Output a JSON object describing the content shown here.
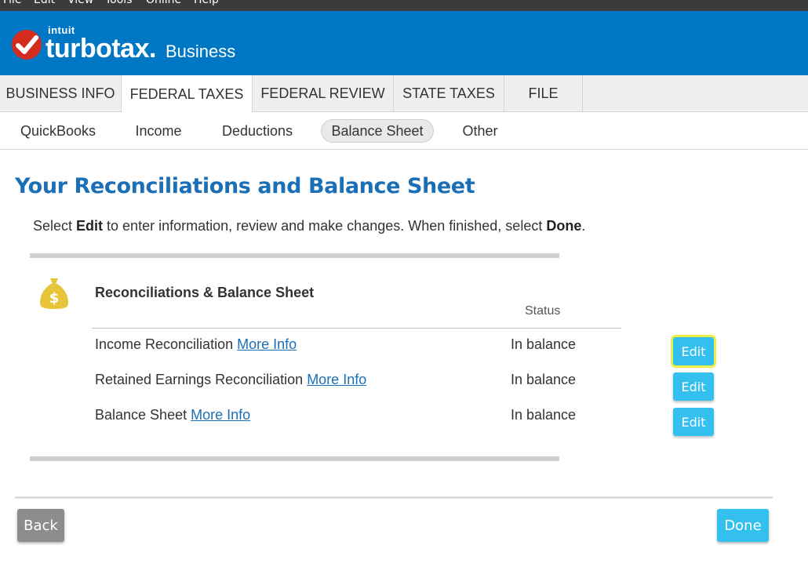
{
  "menu": {
    "items": [
      "File",
      "Edit",
      "View",
      "Tools",
      "Online",
      "Help"
    ]
  },
  "brand": {
    "intuit": "intuit",
    "product": "turbotax.",
    "edition": "Business",
    "background_color": "#0077c5",
    "check_color": "#d52b1e"
  },
  "main_tabs": [
    {
      "label": "BUSINESS INFO",
      "active": false
    },
    {
      "label": "FEDERAL TAXES",
      "active": true
    },
    {
      "label": "FEDERAL REVIEW",
      "active": false
    },
    {
      "label": "STATE TAXES",
      "active": false
    },
    {
      "label": "FILE",
      "active": false
    }
  ],
  "sub_tabs": [
    {
      "label": "QuickBooks",
      "active": false
    },
    {
      "label": "Income",
      "active": false
    },
    {
      "label": "Deductions",
      "active": false
    },
    {
      "label": "Balance Sheet",
      "active": true
    },
    {
      "label": "Other",
      "active": false
    }
  ],
  "page": {
    "title": "Your Reconciliations and Balance Sheet",
    "instruction_pre": "Select ",
    "instruction_edit": "Edit",
    "instruction_mid": " to enter information, review and make changes. When finished, select ",
    "instruction_done": "Done",
    "instruction_post": "."
  },
  "section": {
    "icon": "money-bag-icon",
    "title": "Reconciliations & Balance Sheet",
    "status_header": "Status",
    "rows": [
      {
        "label": "Income Reconciliation",
        "link": "More Info",
        "status": "In balance",
        "button": "Edit"
      },
      {
        "label": "Retained Earnings Reconciliation",
        "link": "More Info",
        "status": "In balance",
        "button": "Edit"
      },
      {
        "label": "Balance Sheet",
        "link": "More Info",
        "status": "In balance",
        "button": "Edit"
      }
    ]
  },
  "footer": {
    "back_label": "Back",
    "done_label": "Done"
  },
  "colors": {
    "accent_button": "#34c0ef",
    "title_blue": "#1b6fb6",
    "back_button": "#8c8c8c"
  }
}
